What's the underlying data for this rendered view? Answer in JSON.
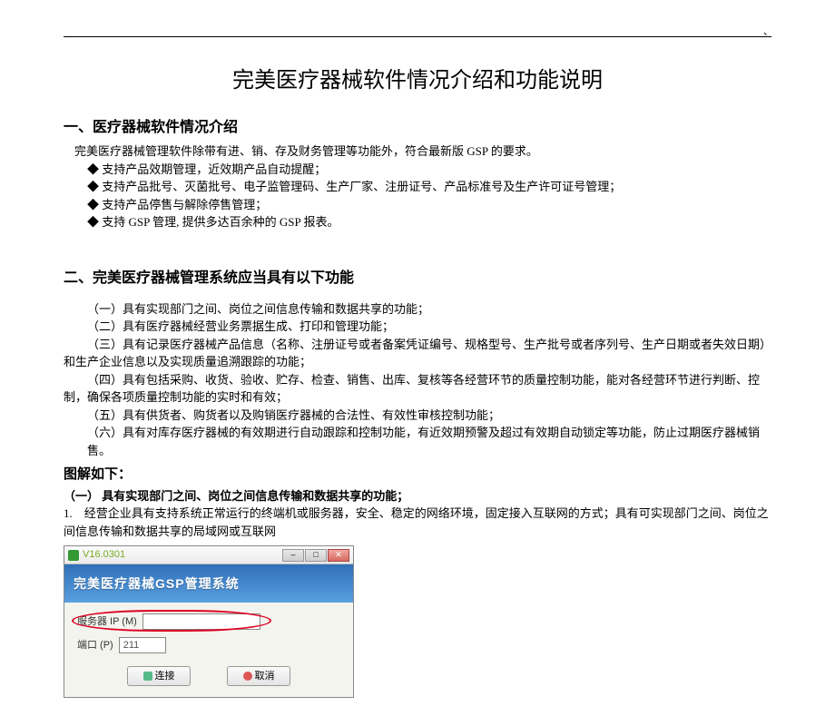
{
  "page_corner": "、",
  "title": "完美医疗器械软件情况介绍和功能说明",
  "section1": {
    "heading": "一、医疗器械软件情况介绍",
    "intro": "完美医疗器械管理软件除带有进、销、存及财务管理等功能外，符合最新版 GSP 的要求。",
    "bullets": [
      "支持产品效期管理，近效期产品自动提醒；",
      "支持产品批号、灭菌批号、电子监管理码、生产厂家、注册证号、产品标准号及生产许可证号管理；",
      "支持产品停售与解除停售管理；",
      "支持 GSP 管理, 提供多达百余种的 GSP 报表。"
    ]
  },
  "section2": {
    "heading": "二、完美医疗器械管理系统应当具有以下功能",
    "items": [
      "（一）具有实现部门之间、岗位之间信息传输和数据共享的功能；",
      "（二）具有医疗器械经营业务票据生成、打印和管理功能；",
      "（三）具有记录医疗器械产品信息（名称、注册证号或者备案凭证编号、规格型号、生产批号或者序列号、生产日期或者失效日期）和生产企业信息以及实现质量追溯跟踪的功能；",
      "（四）具有包括采购、收货、验收、贮存、检查、销售、出库、复核等各经营环节的质量控制功能，能对各经营环节进行判断、控制，确保各项质量控制功能的实时和有效；",
      "（五）具有供货者、购货者以及购销医疗器械的合法性、有效性审核控制功能；",
      "（六）具有对库存医疗器械的有效期进行自动跟踪和控制功能，有近效期预警及超过有效期自动锁定等功能，防止过期医疗器械销售。"
    ]
  },
  "illustration": {
    "heading": "图解如下：",
    "sub": "（一） 具有实现部门之间、岗位之间信息传输和数据共享的功能；",
    "para_prefix": "1.",
    "para": "经营企业具有支持系统正常运行的终端机或服务器，安全、稳定的网络环境，固定接入互联网的方式；具有可实现部门之间、岗位之间信息传输和数据共享的局域网或互联网"
  },
  "screenshot": {
    "version": "V16.0301",
    "banner": "完美医疗器械GSP管理系统",
    "ip_label": "服务器 IP (M)",
    "ip_value": "",
    "port_label": "端口 (P)",
    "port_value": "211",
    "connect": "连接",
    "cancel": "取消",
    "win_min": "–",
    "win_max": "□",
    "win_close": "✕"
  }
}
